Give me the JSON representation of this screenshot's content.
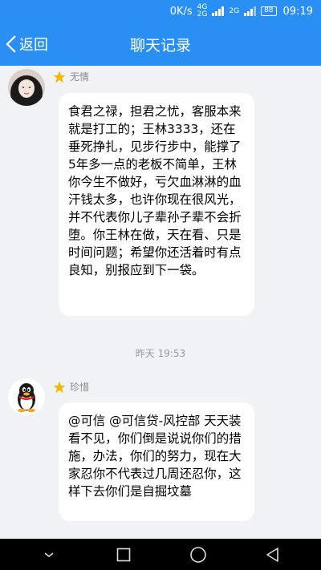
{
  "status_bar": {
    "speed": "0K/s",
    "net_top": "4G",
    "net_bottom": "2G",
    "net2": "2G",
    "battery": "88",
    "time": "09:19"
  },
  "nav": {
    "back_label": "返回",
    "title": "聊天记录"
  },
  "messages": [
    {
      "sender": "无情",
      "text": "食君之禄，担君之忧，客服本来就是打工的；王林3333，还在垂死挣扎，见步行步中，能撑了5年多一点的老板不简单，王林你今生不做好，亏欠血淋淋的血汗钱太多，也许你现在很风光，并不代表你儿子辈孙子辈不会折堕。你王林在做，天在看、只是时间问题；希望你还活着时有点良知，别报应到下一袋。"
    },
    {
      "sender": "珍惜",
      "text": "@可信 @可信贷-风控部 天天装看不见，你们倒是说说你们的措施，办法，你们的努力，现在大家忍你不代表过几周还忍你，这样下去你们是自掘坟墓"
    }
  ],
  "timestamp": "昨天 19:53",
  "colors": {
    "accent": "#2a8ff2",
    "background": "#f0f2f5",
    "bubble": "#ffffff",
    "star": "#f5b800"
  }
}
